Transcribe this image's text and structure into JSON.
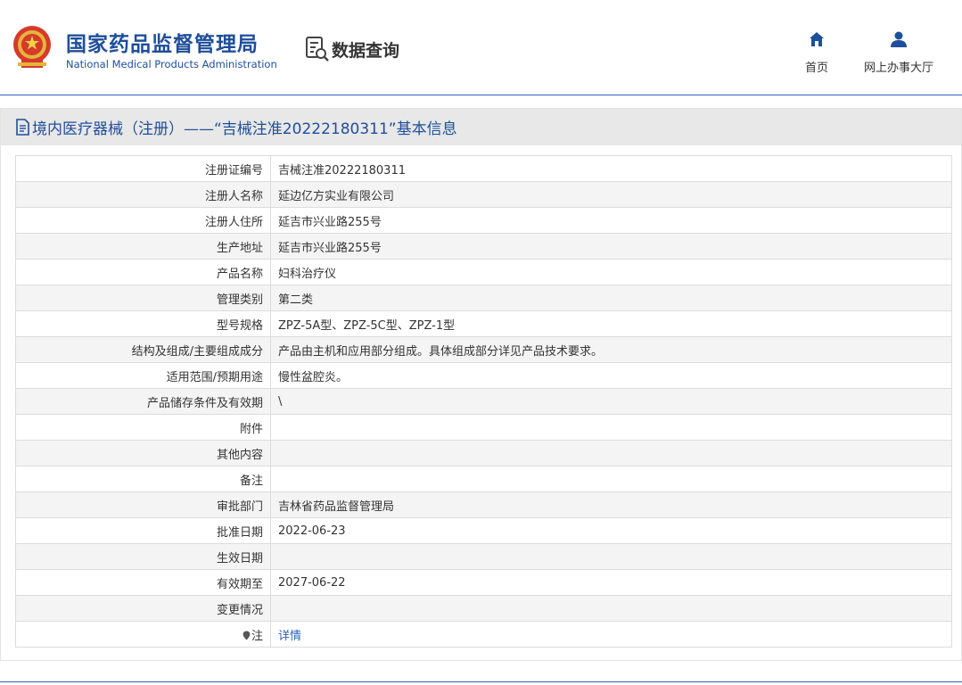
{
  "header": {
    "title": "国家药品监督管理局",
    "subtitle": "National Medical Products Administration",
    "data_query_label": "数据查询",
    "nav": [
      {
        "label": "首页",
        "icon": "home-icon"
      },
      {
        "label": "网上办事大厅",
        "icon": "user-icon"
      }
    ]
  },
  "panel": {
    "title": "境内医疗器械（注册）——“吉械注准20222180311”基本信息"
  },
  "fields": [
    {
      "label": "注册证编号",
      "value": "吉械注准20222180311"
    },
    {
      "label": "注册人名称",
      "value": "延边亿方实业有限公司"
    },
    {
      "label": "注册人住所",
      "value": "延吉市兴业路255号"
    },
    {
      "label": "生产地址",
      "value": "延吉市兴业路255号"
    },
    {
      "label": "产品名称",
      "value": "妇科治疗仪"
    },
    {
      "label": "管理类别",
      "value": "第二类"
    },
    {
      "label": "型号规格",
      "value": "ZPZ-5A型、ZPZ-5C型、ZPZ-1型"
    },
    {
      "label": "结构及组成/主要组成成分",
      "value": "产品由主机和应用部分组成。具体组成部分详见产品技术要求。"
    },
    {
      "label": "适用范围/预期用途",
      "value": "慢性盆腔炎。"
    },
    {
      "label": "产品储存条件及有效期",
      "value": "\\"
    },
    {
      "label": "附件",
      "value": ""
    },
    {
      "label": "其他内容",
      "value": ""
    },
    {
      "label": "备注",
      "value": ""
    },
    {
      "label": "审批部门",
      "value": "吉林省药品监督管理局"
    },
    {
      "label": "批准日期",
      "value": "2022-06-23"
    },
    {
      "label": "生效日期",
      "value": ""
    },
    {
      "label": "有效期至",
      "value": "2027-06-22"
    },
    {
      "label": "变更情况",
      "value": ""
    }
  ],
  "note_row": {
    "label": "注",
    "link": "详情"
  },
  "colors": {
    "brand_blue": "#1f4e9a",
    "link_blue": "#2b64b8",
    "row_alt": "#f4f4f4",
    "header_bar": "#e8e8e8"
  }
}
